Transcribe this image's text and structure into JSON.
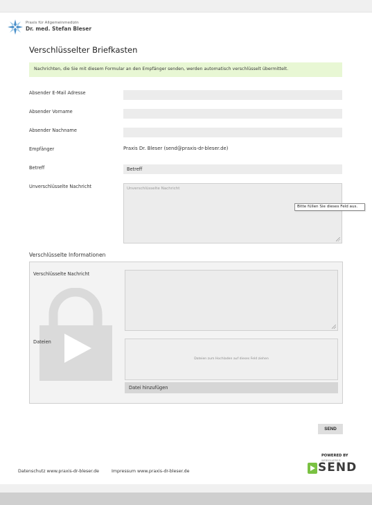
{
  "brand": {
    "line1": "Praxis für Allgemeinmedizin",
    "line2": "Dr. med. Stefan Bleser"
  },
  "page": {
    "title": "Verschlüsselter Briefkasten",
    "notice": "Nachrichten, die Sie mit diesem Formular an den Empfänger senden, werden automatisch verschlüsselt übermittelt."
  },
  "form": {
    "email_label": "Absender E-Mail Adresse",
    "email_value": "",
    "firstname_label": "Absender Vorname",
    "firstname_value": "",
    "lastname_label": "Absender Nachname",
    "lastname_value": "",
    "recipient_label": "Empfänger",
    "recipient_value": "Praxis Dr. Bleser (send@praxis-dr-bleser.de)",
    "subject_label": "Betreff",
    "subject_value": "Betreff",
    "message_label": "Unverschlüsselte Nachricht",
    "message_placeholder": "Unverschlüsselte Nachricht",
    "tooltip": "Bitte füllen Sie dieses Feld aus."
  },
  "encrypted": {
    "section_title": "Verschlüsselte Informationen",
    "message_label": "Verschlüsselte Nachricht",
    "files_label": "Dateien",
    "dropzone_text": "Dateien zum Hochladen auf dieses Feld ziehen",
    "add_file_label": "Datei hinzufügen"
  },
  "actions": {
    "send_label": "SEND"
  },
  "powered": {
    "by": "POWERED BY",
    "vendor": "WEBSOLVERS®",
    "product": "SEND"
  },
  "footer": {
    "privacy": "Datenschutz www.praxis-dr-bleser.de",
    "imprint": "Impressum www.praxis-dr-bleser.de"
  },
  "icons": {
    "brand": "star-cross-logo-icon",
    "lock": "lock-play-icon",
    "resize": "resize-grip-icon",
    "powered_mark": "send-logo-icon"
  },
  "colors": {
    "notice_bg": "#e8f7d4",
    "field_bg": "#ececec",
    "send_green": "#7ac142",
    "brand_blue": "#4a8fc9"
  }
}
